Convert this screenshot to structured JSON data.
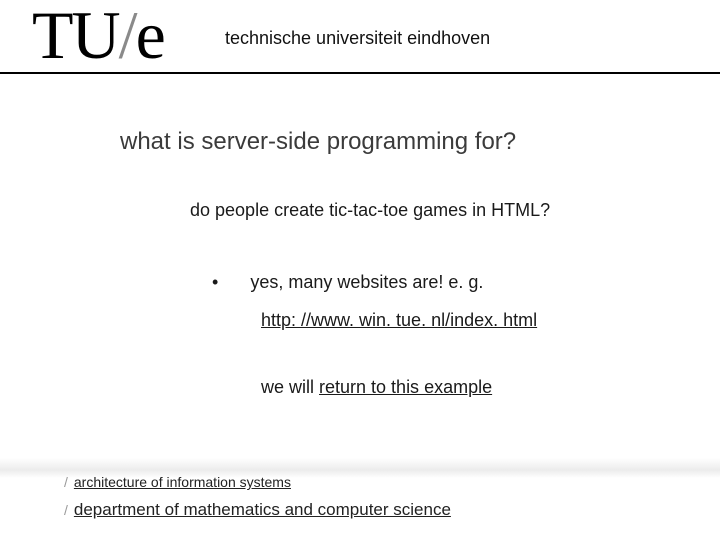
{
  "header": {
    "logo_tu": "TU",
    "logo_slash": "/",
    "logo_e": "e",
    "university": "technische universiteit eindhoven"
  },
  "slide": {
    "title": "what is server-side programming for?",
    "question": "do people create tic-tac-toe games in HTML?",
    "bullet_mark": "•",
    "bullet_text": "yes, many websites are!  e. g.",
    "link": "http: //www. win. tue. nl/index. html",
    "return_prefix": "we will ",
    "return_underlined": "return to this example"
  },
  "footer": {
    "slash": "/",
    "line1": "architecture of information systems",
    "line2": "department of mathematics and computer science"
  }
}
